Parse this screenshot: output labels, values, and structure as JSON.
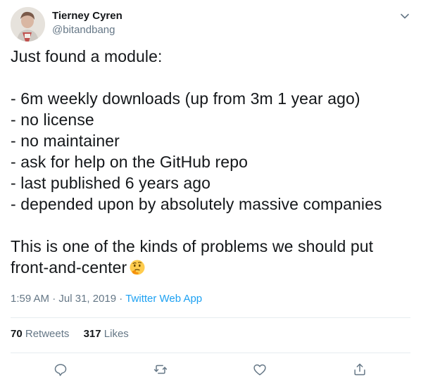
{
  "author": {
    "display_name": "Tierney Cyren",
    "handle": "@bitandbang"
  },
  "tweet": {
    "lines": [
      "Just found a module:",
      "",
      "- 6m weekly downloads (up from 3m 1 year ago)",
      "- no license",
      "- no maintainer",
      "- ask for help on the GitHub repo",
      "- last published 6 years ago",
      "- depended upon by absolutely massive companies",
      "",
      "This is one of the kinds of problems we should put",
      "front-and-center"
    ],
    "emoji": "thinking-face"
  },
  "meta": {
    "time": "1:59 AM",
    "separator_1": "·",
    "date": "Jul 31, 2019",
    "separator_2": "·",
    "source": "Twitter Web App"
  },
  "stats": {
    "retweets_count": "70",
    "retweets_label": "Retweets",
    "likes_count": "317",
    "likes_label": "Likes"
  },
  "actions": [
    "reply-icon",
    "retweet-icon",
    "like-icon",
    "share-icon"
  ],
  "colors": {
    "text": "#14171a",
    "secondary": "#657786",
    "link": "#1da1f2",
    "divider": "#e6ecf0"
  }
}
